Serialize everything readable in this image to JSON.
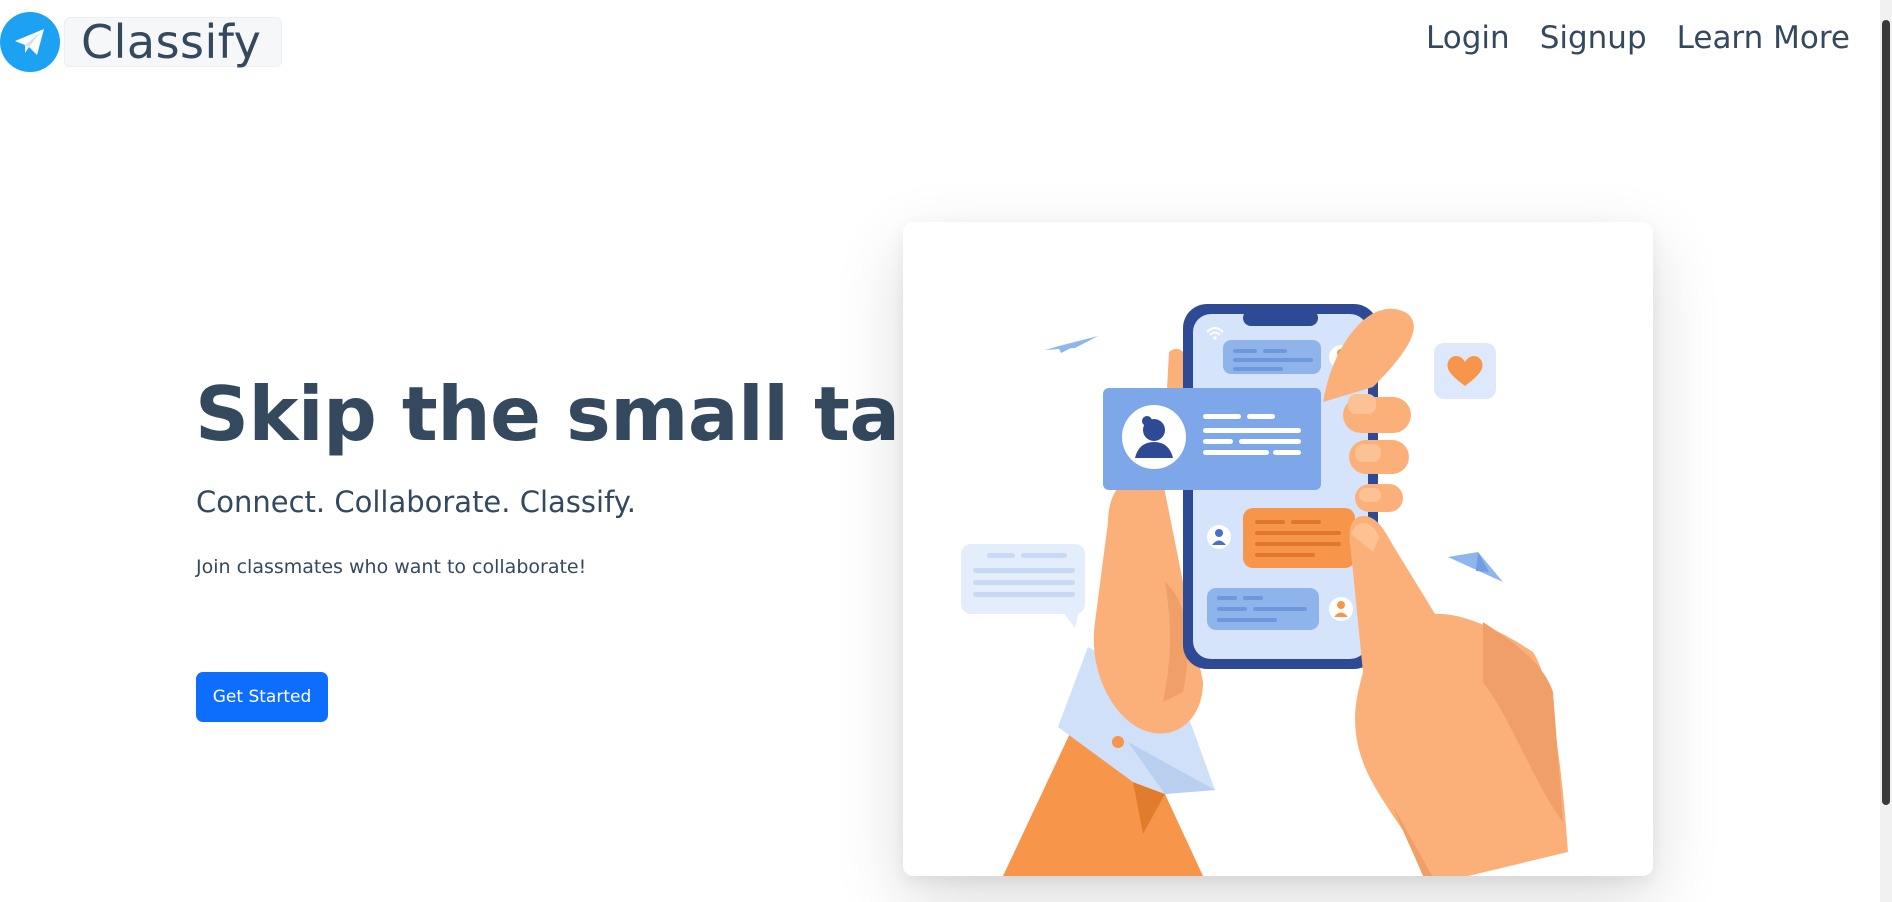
{
  "brand": {
    "name": "Classify",
    "logo_icon": "paper-plane-icon",
    "logo_color": "#1da1f2"
  },
  "nav": {
    "links": [
      {
        "label": "Login"
      },
      {
        "label": "Signup"
      },
      {
        "label": "Learn More"
      }
    ]
  },
  "hero": {
    "title": "Skip the small talk",
    "subtitle": "Connect. Collaborate. Classify.",
    "text": "Join classmates who want to collaborate!",
    "cta_label": "Get Started"
  },
  "colors": {
    "text": "#34495e",
    "accent": "#0d6efd",
    "illustration_orange": "#f7964a",
    "illustration_blue": "#7ea7ea"
  }
}
